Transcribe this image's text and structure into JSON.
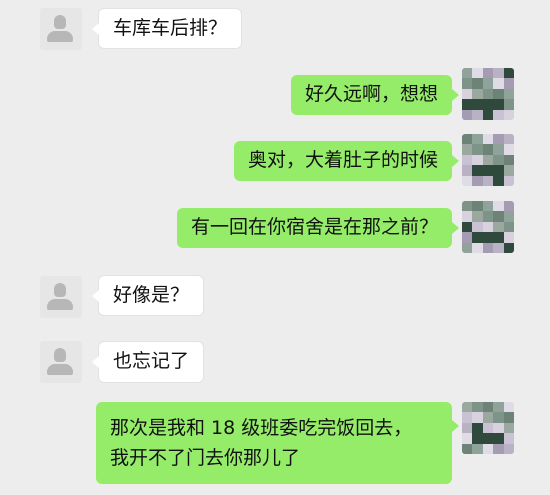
{
  "colors": {
    "background": "#ededed",
    "incoming_bubble": "#ffffff",
    "outgoing_bubble": "#95ec69",
    "text": "#111111"
  },
  "messages": [
    {
      "side": "incoming",
      "avatar": "default-avatar-icon",
      "text": "车库车后排？"
    },
    {
      "side": "outgoing",
      "avatar": "mosaic-avatar",
      "text": "好久远啊，想想"
    },
    {
      "side": "outgoing",
      "avatar": "mosaic-avatar",
      "text": "奥对，大着肚子的时候"
    },
    {
      "side": "outgoing",
      "avatar": "mosaic-avatar",
      "text": "有一回在你宿舍是在那之前？"
    },
    {
      "side": "incoming",
      "avatar": "default-avatar-icon",
      "text": "好像是？"
    },
    {
      "side": "incoming",
      "avatar": "default-avatar-icon",
      "text": "也忘记了"
    },
    {
      "side": "outgoing",
      "avatar": "mosaic-avatar",
      "lines": [
        "那次是我和 18 级班委吃完饭回去，",
        "我开不了门去你那儿了"
      ]
    }
  ]
}
